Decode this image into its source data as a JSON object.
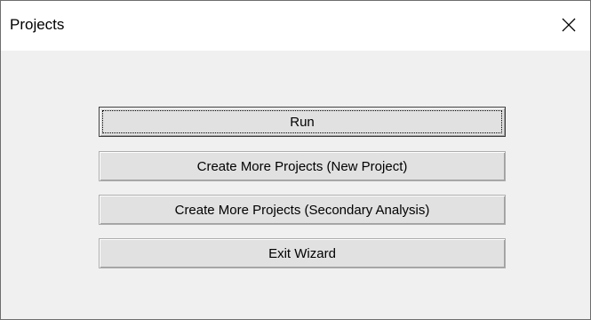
{
  "window": {
    "title": "Projects",
    "close_icon": "close-icon"
  },
  "buttons": {
    "run": "Run",
    "new_project": "Create More Projects (New Project)",
    "secondary_analysis": "Create More Projects (Secondary Analysis)",
    "exit_wizard": "Exit Wizard"
  }
}
